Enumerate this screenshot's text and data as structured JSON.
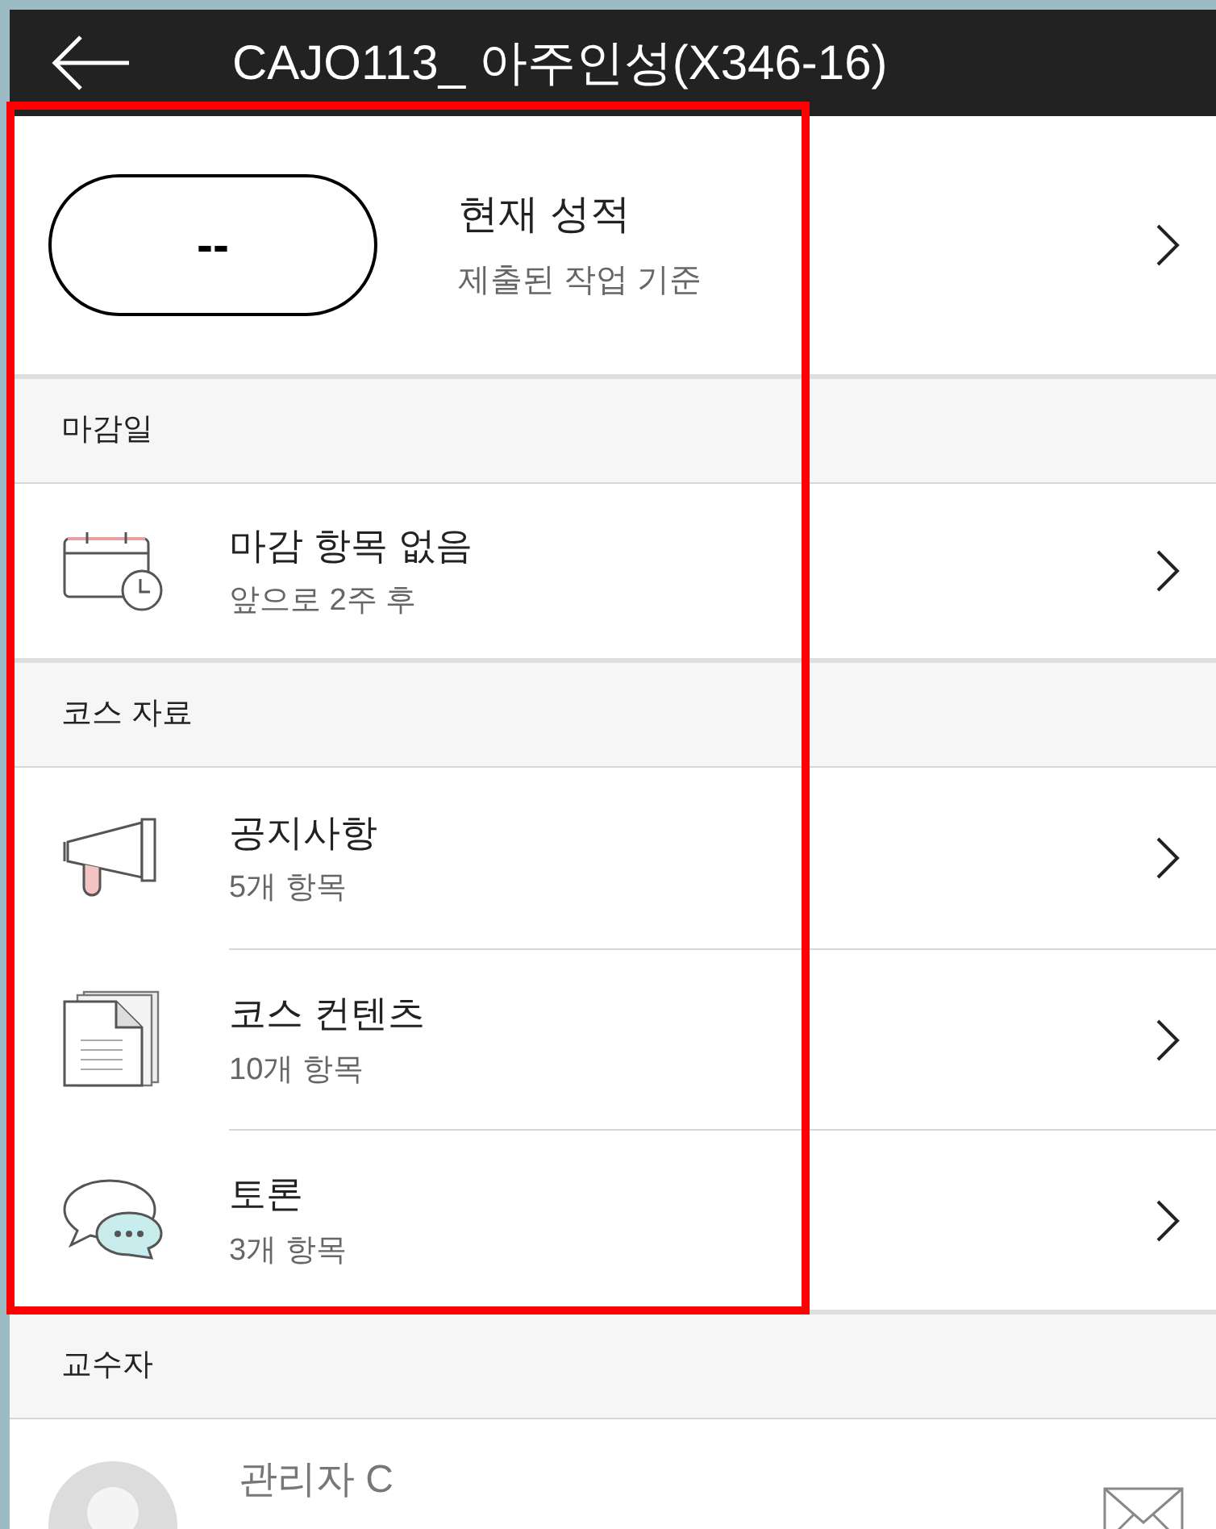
{
  "header": {
    "title": "CAJO113_ 아주인성(X346-16)"
  },
  "grade": {
    "value": "--",
    "title": "현재 성적",
    "subtitle": "제출된 작업 기준"
  },
  "sections": [
    {
      "heading": "마감일",
      "kind": "list",
      "items": [
        {
          "kind": "calendar",
          "title": "마감 항목 없음",
          "subtitle": "앞으로 2주 후"
        }
      ]
    },
    {
      "heading": "코스 자료",
      "kind": "list",
      "items": [
        {
          "kind": "megaphone",
          "title": "공지사항",
          "subtitle": "5개 항목"
        },
        {
          "kind": "documents",
          "title": "코스 컨텐츠",
          "subtitle": "10개 항목"
        },
        {
          "kind": "discussion",
          "title": "토론",
          "subtitle": "3개 항목"
        }
      ]
    },
    {
      "heading": "교수자",
      "kind": "people",
      "items": [
        {
          "title": "관리자 C"
        }
      ]
    }
  ]
}
